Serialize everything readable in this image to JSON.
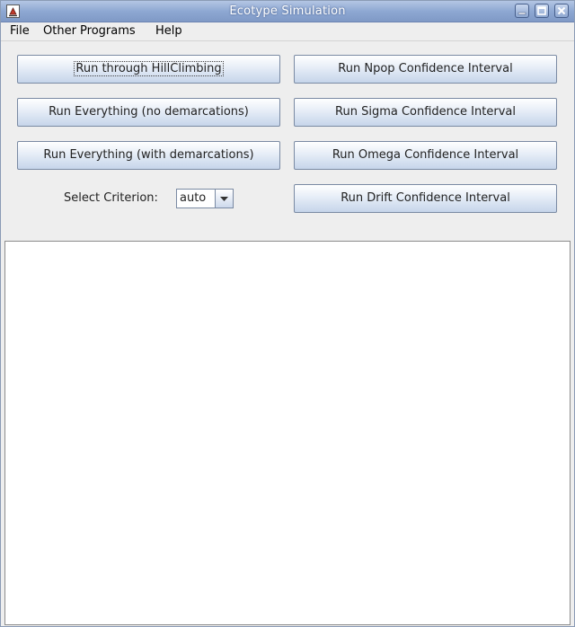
{
  "window": {
    "title": "Ecotype Simulation",
    "app_icon": "java-app-icon",
    "controls": {
      "minimize_icon": "minimize-icon",
      "maximize_icon": "maximize-icon",
      "close_icon": "close-icon"
    }
  },
  "menubar": {
    "items": [
      {
        "label": "File"
      },
      {
        "label": "Other Programs"
      },
      {
        "label": "Help"
      }
    ]
  },
  "buttons": {
    "hillclimbing": "Run through HillClimbing",
    "everything_no_demarcations": "Run Everything (no demarcations)",
    "everything_with_demarcations": "Run Everything (with demarcations)",
    "npop_ci": "Run Npop Confidence Interval",
    "sigma_ci": "Run Sigma Confidence Interval",
    "omega_ci": "Run Omega Confidence Interval",
    "drift_ci": "Run Drift Confidence Interval"
  },
  "criterion": {
    "label": "Select Criterion:",
    "selected": "auto",
    "arrow_icon": "chevron-down-icon"
  },
  "output": {
    "text": ""
  },
  "colors": {
    "titlebar": "#8ea8d2",
    "window_bg": "#eeeeee",
    "button_border": "#7a8aa3",
    "output_bg": "#ffffff"
  }
}
